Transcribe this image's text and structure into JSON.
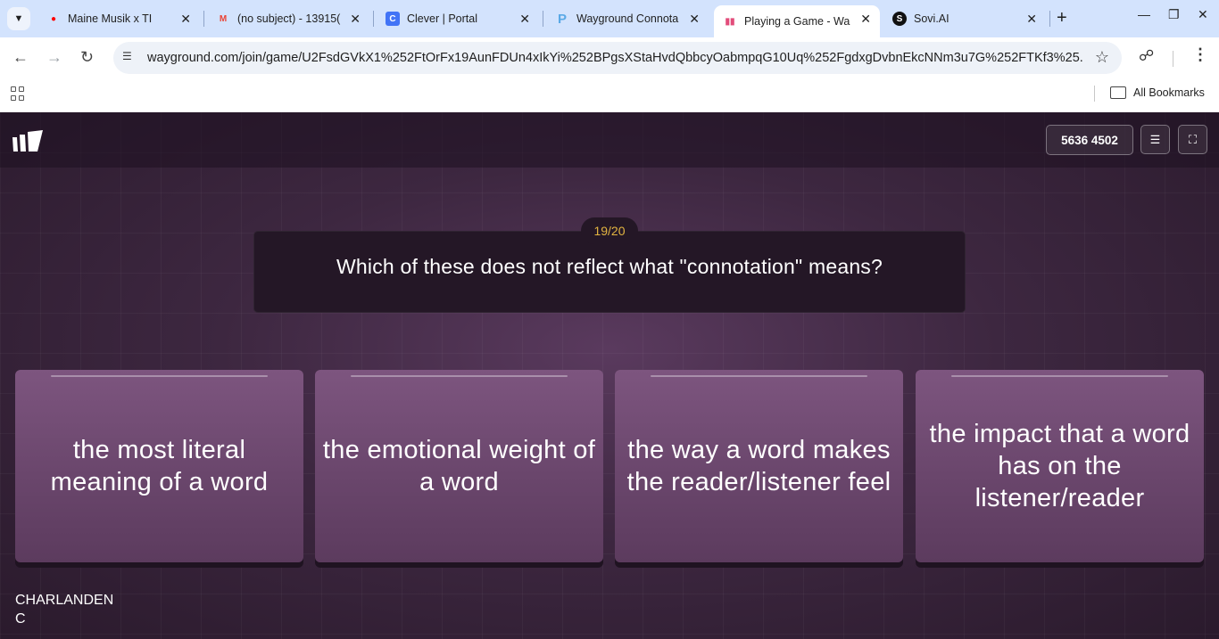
{
  "browser": {
    "tabs": [
      {
        "title": "Maine Musik x TI",
        "favicon": "youtube-icon",
        "color": "#ff0000"
      },
      {
        "title": "(no subject) - 13915(",
        "favicon": "gmail-icon",
        "color": "#ea4335"
      },
      {
        "title": "Clever | Portal",
        "favicon": "clever-icon",
        "color": "#4274f6"
      },
      {
        "title": "Wayground Connota",
        "favicon": "wayground-p-icon",
        "color": "#5aa9e6"
      },
      {
        "title": "Playing a Game - Wa",
        "favicon": "wayground-icon",
        "color": "#e24c7a"
      },
      {
        "title": "Sovi.AI",
        "favicon": "sovi-icon",
        "color": "#111111"
      }
    ],
    "url": "wayground.com/join/game/U2FsdGVkX1%252FtOrFx19AunFDUn4xIkYi%252BPgsXStaHvdQbbcyOabmpqG10Uq%252FgdxgDvbnEkcNNm3u7G%252FTKf3%25...",
    "bookmarks_label": "All Bookmarks"
  },
  "game": {
    "code": "5636 4502",
    "question_counter": "19/20",
    "question": "Which of these does not reflect what \"connotation\" means?",
    "options": [
      "the most literal meaning of a word",
      "the emotional weight of a word",
      "the way a word makes the reader/listener feel",
      "the impact that a word has on the listener/reader"
    ],
    "player_name_line1": "CHARLANDEN",
    "player_name_line2": "C"
  }
}
